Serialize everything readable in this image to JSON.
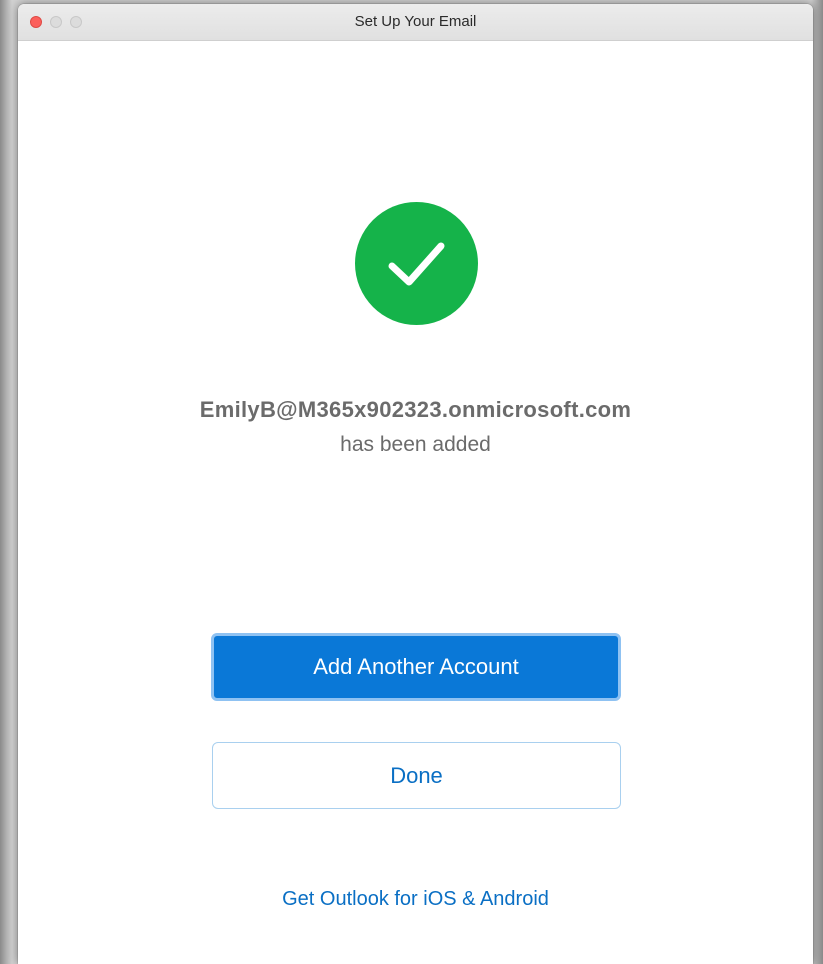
{
  "window": {
    "title": "Set Up Your Email"
  },
  "status": {
    "icon": "checkmark-icon",
    "icon_color": "#15b34a",
    "email": "EmilyB@M365x902323.onmicrosoft.com",
    "message": "has been added"
  },
  "actions": {
    "add_account_label": "Add Another Account",
    "done_label": "Done",
    "mobile_link_label": "Get Outlook for iOS & Android"
  },
  "colors": {
    "primary_button": "#0a78d7",
    "link": "#0a6fc4",
    "close_button": "#fc605c"
  }
}
